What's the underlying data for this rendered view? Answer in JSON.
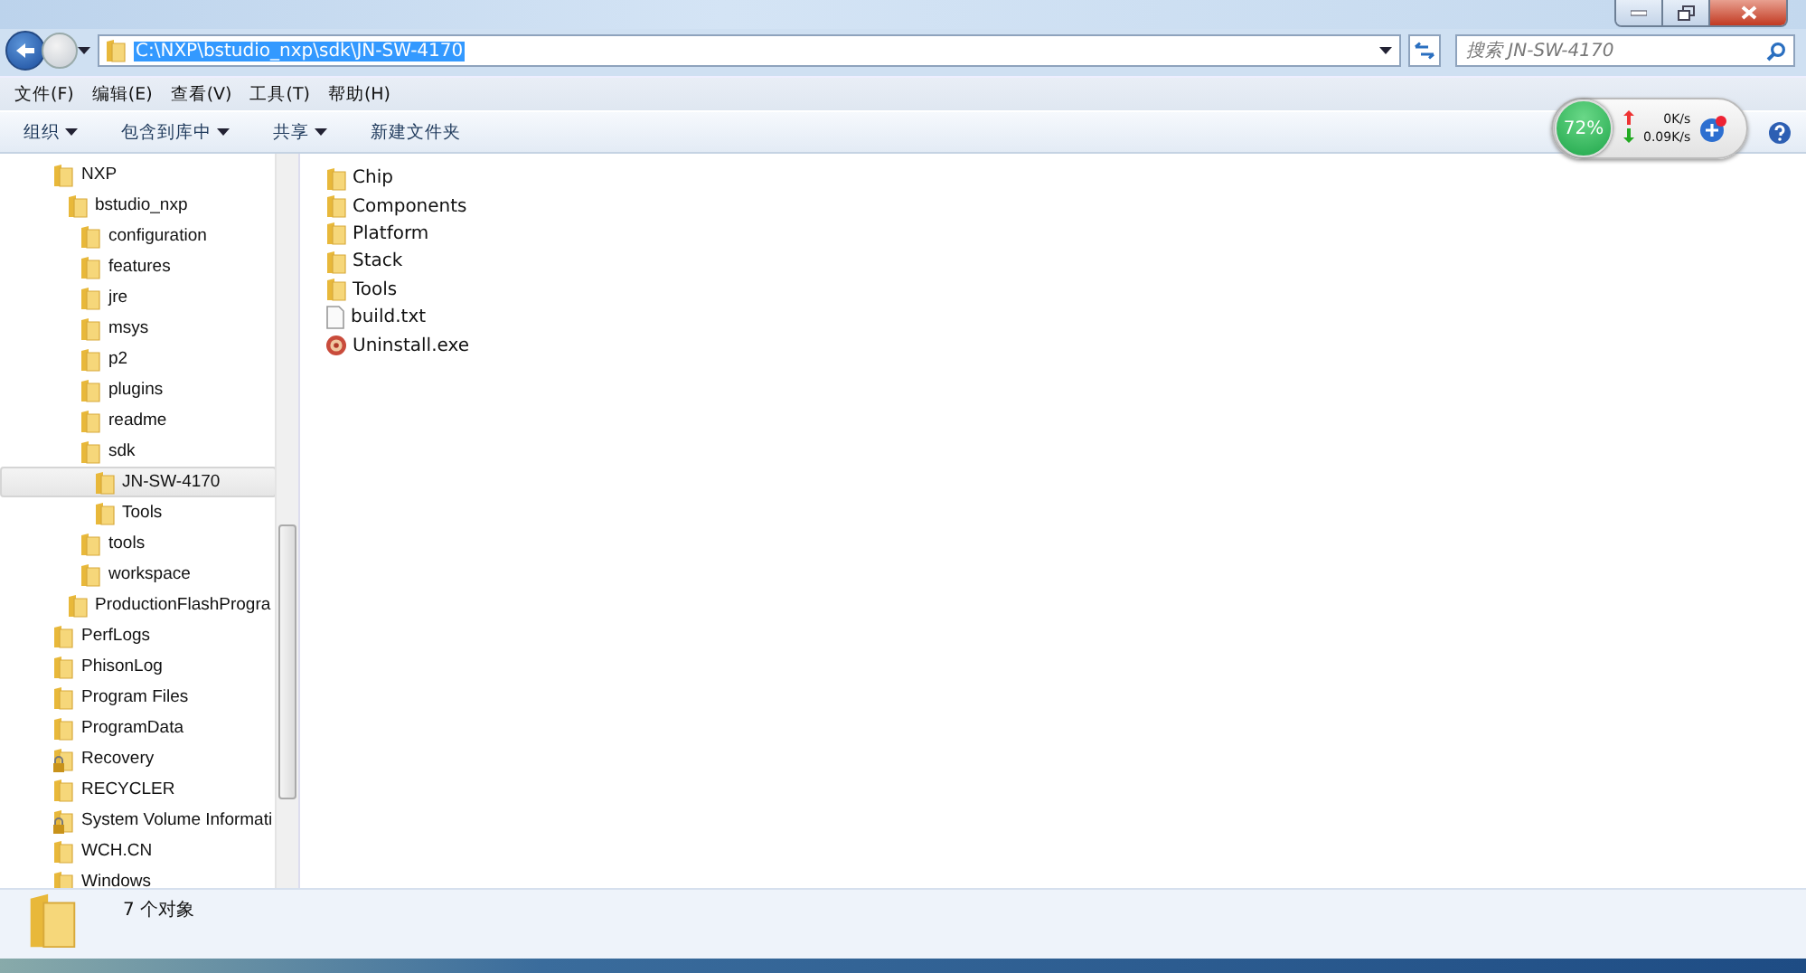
{
  "address_bar": {
    "value": "C:\\NXP\\bstudio_nxp\\sdk\\JN-SW-4170",
    "selected": true
  },
  "search": {
    "placeholder": "搜索 JN-SW-4170"
  },
  "menu": [
    "文件(F)",
    "编辑(E)",
    "查看(V)",
    "工具(T)",
    "帮助(H)"
  ],
  "toolbar": [
    {
      "label": "组织",
      "dropdown": true
    },
    {
      "label": "包含到库中",
      "dropdown": true
    },
    {
      "label": "共享",
      "dropdown": true
    },
    {
      "label": "新建文件夹",
      "dropdown": false
    }
  ],
  "net_monitor": {
    "percent": "72%",
    "upload": "0K/s",
    "download": "0.09K/s"
  },
  "tree": [
    {
      "label": "NXP",
      "locked": false,
      "selected": false,
      "children": [
        {
          "label": "bstudio_nxp",
          "locked": false,
          "selected": false,
          "children": [
            {
              "label": "configuration",
              "locked": false,
              "selected": false
            },
            {
              "label": "features",
              "locked": false,
              "selected": false
            },
            {
              "label": "jre",
              "locked": false,
              "selected": false
            },
            {
              "label": "msys",
              "locked": false,
              "selected": false
            },
            {
              "label": "p2",
              "locked": false,
              "selected": false
            },
            {
              "label": "plugins",
              "locked": false,
              "selected": false
            },
            {
              "label": "readme",
              "locked": false,
              "selected": false
            },
            {
              "label": "sdk",
              "locked": false,
              "selected": false,
              "children": [
                {
                  "label": "JN-SW-4170",
                  "locked": false,
                  "selected": true
                },
                {
                  "label": "Tools",
                  "locked": false,
                  "selected": false
                }
              ]
            },
            {
              "label": "tools",
              "locked": false,
              "selected": false
            },
            {
              "label": "workspace",
              "locked": false,
              "selected": false
            }
          ]
        },
        {
          "label": "ProductionFlashProgra",
          "locked": false,
          "selected": false
        }
      ]
    },
    {
      "label": "PerfLogs",
      "locked": false,
      "selected": false
    },
    {
      "label": "PhisonLog",
      "locked": false,
      "selected": false
    },
    {
      "label": "Program Files",
      "locked": false,
      "selected": false
    },
    {
      "label": "ProgramData",
      "locked": false,
      "selected": false
    },
    {
      "label": "Recovery",
      "locked": true,
      "selected": false
    },
    {
      "label": "RECYCLER",
      "locked": false,
      "selected": false
    },
    {
      "label": "System Volume Informati",
      "locked": true,
      "selected": false
    },
    {
      "label": "WCH.CN",
      "locked": false,
      "selected": false
    },
    {
      "label": "Windows",
      "locked": false,
      "selected": false
    }
  ],
  "files": [
    {
      "name": "Chip",
      "kind": "folder"
    },
    {
      "name": "Components",
      "kind": "folder"
    },
    {
      "name": "Platform",
      "kind": "folder"
    },
    {
      "name": "Stack",
      "kind": "folder"
    },
    {
      "name": "Tools",
      "kind": "folder"
    },
    {
      "name": "build.txt",
      "kind": "text"
    },
    {
      "name": "Uninstall.exe",
      "kind": "exe"
    }
  ],
  "status_bar": {
    "text": "7 个对象"
  }
}
